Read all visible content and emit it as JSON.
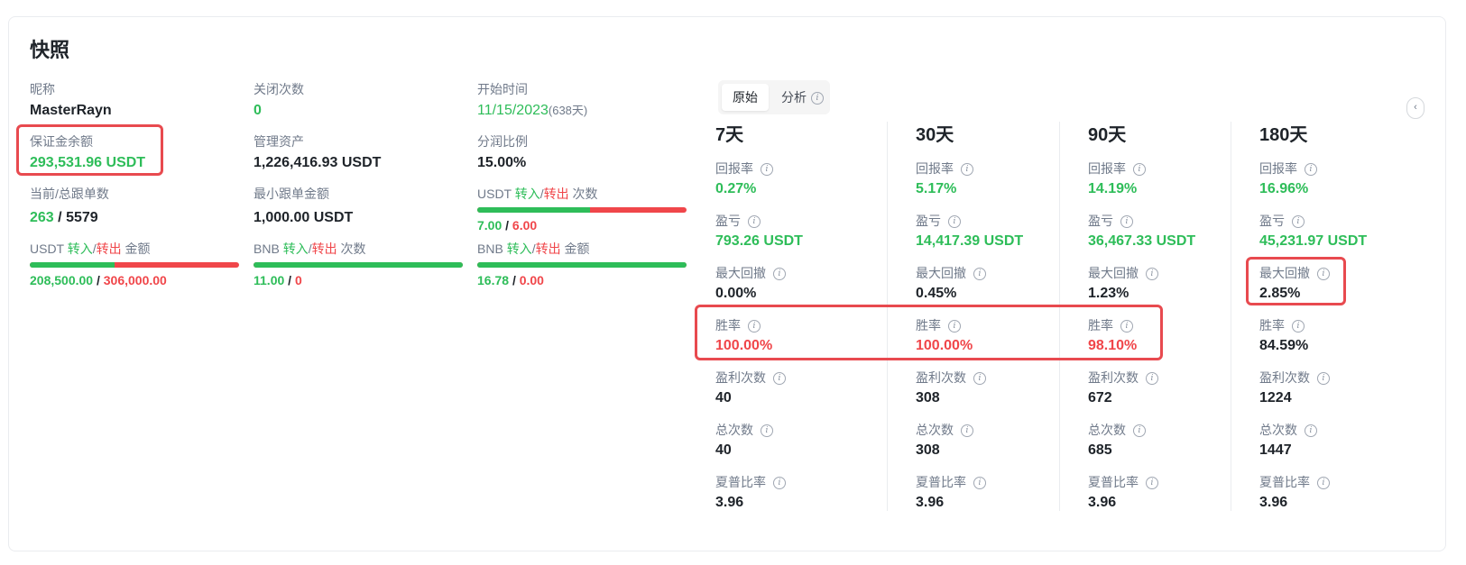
{
  "title": "快照",
  "left": {
    "nickname": {
      "label": "昵称",
      "value": "MasterRayn"
    },
    "margin_balance": {
      "label": "保证金余额",
      "value": "293,531.96 USDT"
    },
    "copiers": {
      "label": "当前/总跟单数",
      "current": "263",
      "sep": "/",
      "total": "5579"
    },
    "usdt_amount": {
      "prefix": "USDT",
      "in": "转入",
      "slash": "/",
      "out": "转出",
      "suffix": "金额",
      "in_value": "208,500.00",
      "sep": "/",
      "out_value": "306,000.00",
      "in_share": 0.405
    },
    "close_count": {
      "label": "关闭次数",
      "value": "0"
    },
    "aum": {
      "label": "管理资产",
      "value": "1,226,416.93 USDT"
    },
    "min_copy": {
      "label": "最小跟单金额",
      "value": "1,000.00 USDT"
    },
    "bnb_count": {
      "prefix": "BNB",
      "in": "转入",
      "slash": "/",
      "out": "转出",
      "suffix": "次数",
      "in_value": "11.00",
      "sep": "/",
      "out_value": "0",
      "in_share": 1.0
    },
    "start_time": {
      "label": "开始时间",
      "date": "11/15/2023",
      "days": "(638天)"
    },
    "profit_share": {
      "label": "分润比例",
      "value": "15.00%"
    },
    "usdt_count": {
      "prefix": "USDT",
      "in": "转入",
      "slash": "/",
      "out": "转出",
      "suffix": "次数",
      "in_value": "7.00",
      "sep": "/",
      "out_value": "6.00",
      "in_share": 0.538
    },
    "bnb_amount": {
      "prefix": "BNB",
      "in": "转入",
      "slash": "/",
      "out": "转出",
      "suffix": "金额",
      "in_value": "16.78",
      "sep": "/",
      "out_value": "0.00",
      "in_share": 1.0
    }
  },
  "tabs": [
    {
      "label": "原始",
      "active": true
    },
    {
      "label": "分析",
      "active": false
    }
  ],
  "info_glyph": "i",
  "colors": {
    "green": "#2ebd59",
    "red": "#f0464a",
    "highlight": "#e84a4f"
  },
  "periods": [
    {
      "name": "7天",
      "metrics": [
        {
          "label": "回报率",
          "value": "0.27%",
          "tone": "green"
        },
        {
          "label": "盈亏",
          "value": "793.26 USDT",
          "tone": "green"
        },
        {
          "label": "最大回撤",
          "value": "0.00%",
          "tone": "dark"
        },
        {
          "label": "胜率",
          "value": "100.00%",
          "tone": "red"
        },
        {
          "label": "盈利次数",
          "value": "40",
          "tone": "dark"
        },
        {
          "label": "总次数",
          "value": "40",
          "tone": "dark"
        },
        {
          "label": "夏普比率",
          "value": "3.96",
          "tone": "dark"
        }
      ]
    },
    {
      "name": "30天",
      "metrics": [
        {
          "label": "回报率",
          "value": "5.17%",
          "tone": "green"
        },
        {
          "label": "盈亏",
          "value": "14,417.39 USDT",
          "tone": "green"
        },
        {
          "label": "最大回撤",
          "value": "0.45%",
          "tone": "dark"
        },
        {
          "label": "胜率",
          "value": "100.00%",
          "tone": "red"
        },
        {
          "label": "盈利次数",
          "value": "308",
          "tone": "dark"
        },
        {
          "label": "总次数",
          "value": "308",
          "tone": "dark"
        },
        {
          "label": "夏普比率",
          "value": "3.96",
          "tone": "dark"
        }
      ]
    },
    {
      "name": "90天",
      "metrics": [
        {
          "label": "回报率",
          "value": "14.19%",
          "tone": "green"
        },
        {
          "label": "盈亏",
          "value": "36,467.33 USDT",
          "tone": "green"
        },
        {
          "label": "最大回撤",
          "value": "1.23%",
          "tone": "dark"
        },
        {
          "label": "胜率",
          "value": "98.10%",
          "tone": "red"
        },
        {
          "label": "盈利次数",
          "value": "672",
          "tone": "dark"
        },
        {
          "label": "总次数",
          "value": "685",
          "tone": "dark"
        },
        {
          "label": "夏普比率",
          "value": "3.96",
          "tone": "dark"
        }
      ]
    },
    {
      "name": "180天",
      "metrics": [
        {
          "label": "回报率",
          "value": "16.96%",
          "tone": "green"
        },
        {
          "label": "盈亏",
          "value": "45,231.97 USDT",
          "tone": "green"
        },
        {
          "label": "最大回撤",
          "value": "2.85%",
          "tone": "dark"
        },
        {
          "label": "胜率",
          "value": "84.59%",
          "tone": "dark"
        },
        {
          "label": "盈利次数",
          "value": "1224",
          "tone": "dark"
        },
        {
          "label": "总次数",
          "value": "1447",
          "tone": "dark"
        },
        {
          "label": "夏普比率",
          "value": "3.96",
          "tone": "dark"
        }
      ]
    }
  ]
}
